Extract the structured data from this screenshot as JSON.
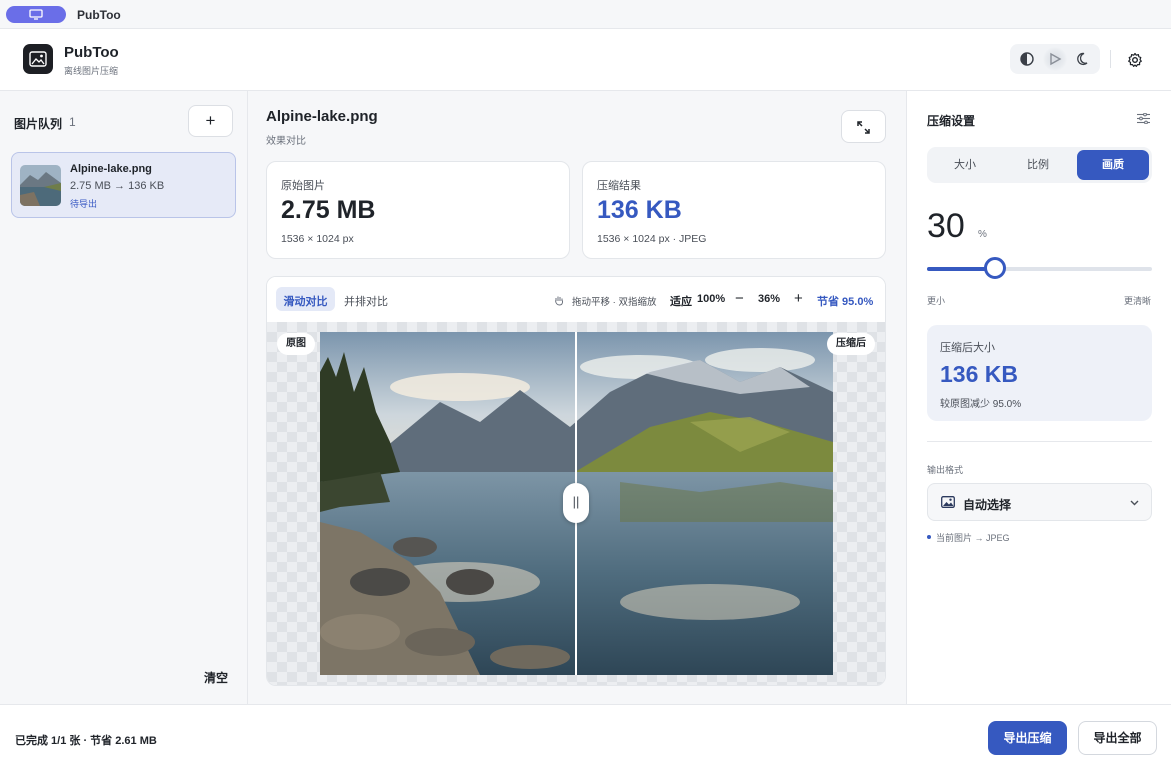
{
  "titlebar": {
    "app_title": "PubToo"
  },
  "header": {
    "app_name": "PubToo",
    "app_subtitle": "离线图片压缩"
  },
  "queue": {
    "title": "图片队列",
    "count": "1",
    "add_label": "+",
    "items": [
      {
        "name": "Alpine-lake.png",
        "size": "2.75 MB → 136 KB",
        "status": "待导出"
      }
    ],
    "clear_label": "清空"
  },
  "preview": {
    "file_name": "Alpine-lake.png",
    "subtitle": "效果对比",
    "original": {
      "label": "原始图片",
      "size": "2.75 MB",
      "meta": "1536 × 1024 px"
    },
    "result": {
      "label": "压缩结果",
      "size": "136 KB",
      "meta": "1536 × 1024 px · JPEG"
    },
    "modes": {
      "slide": "滑动对比",
      "side": "并排对比"
    },
    "pan_hint": "拖动平移 · 双指缩放",
    "zoom": {
      "fit": "适应",
      "full": "100%",
      "minus": "−",
      "value": "36%",
      "plus": "+"
    },
    "saving": "节省 95.0%",
    "tag_original": "原图",
    "tag_compressed": "压缩后",
    "handle_glyph": "||"
  },
  "settings": {
    "title": "压缩设置",
    "tabs": [
      "大小",
      "比例",
      "画质"
    ],
    "active_tab": "画质",
    "quality_value": "30",
    "quality_unit": "%",
    "quality_percent": 30,
    "slider_min_label": "更小",
    "slider_max_label": "更清晰",
    "result_label": "压缩后大小",
    "result_value": "136 KB",
    "result_desc": "较原图减少 95.0%",
    "format_label": "输出格式",
    "format_value": "自动选择",
    "format_note": "当前图片 → JPEG"
  },
  "footer": {
    "status": "已完成 1/1 张 · 节省 2.61 MB",
    "export_compress": "导出压缩",
    "export_all": "导出全部"
  },
  "colors": {
    "accent": "#3659c0",
    "titlebar_pill": "#6a6ee8"
  },
  "icons": [
    "monitor-icon",
    "app-logo-icon",
    "contrast-icon",
    "sun-icon",
    "moon-icon",
    "gear-icon",
    "expand-icon",
    "hand-pan-icon",
    "sliders-icon",
    "image-icon",
    "chevron-down-icon"
  ]
}
